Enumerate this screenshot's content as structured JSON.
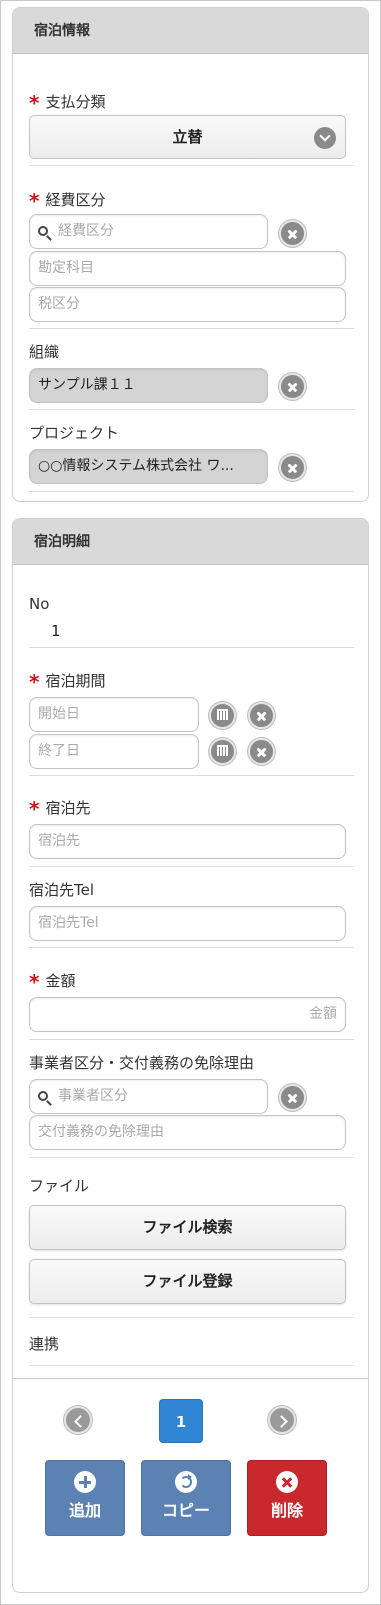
{
  "lodging_info": {
    "header": "宿泊情報",
    "payment_type": {
      "label": "支払分類",
      "value": "立替"
    },
    "expense_category": {
      "label": "経費区分",
      "search_placeholder": "経費区分",
      "account_placeholder": "勘定科目",
      "tax_placeholder": "税区分"
    },
    "organization": {
      "label": "組織",
      "value": "サンプル課１１"
    },
    "project": {
      "label": "プロジェクト",
      "value": "○○情報システム株式会社 ワ..."
    }
  },
  "lodging_detail": {
    "header": "宿泊明細",
    "no": {
      "label": "No",
      "value": "1"
    },
    "period": {
      "label": "宿泊期間",
      "start_placeholder": "開始日",
      "end_placeholder": "終了日"
    },
    "destination": {
      "label": "宿泊先",
      "placeholder": "宿泊先"
    },
    "destination_tel": {
      "label": "宿泊先Tel",
      "placeholder": "宿泊先Tel"
    },
    "amount": {
      "label": "金額",
      "placeholder": "金額"
    },
    "business_type": {
      "label": "事業者区分・交付義務の免除理由",
      "search_placeholder": "事業者区分",
      "reason_placeholder": "交付義務の免除理由"
    },
    "file": {
      "label": "ファイル",
      "search_button": "ファイル検索",
      "register_button": "ファイル登録"
    },
    "link": {
      "label": "連携"
    }
  },
  "pager": {
    "current_page": "1"
  },
  "actions": {
    "add": "追加",
    "copy": "コピー",
    "delete": "削除"
  },
  "colors": {
    "required": "#d4101a",
    "page_active": "#2f86d4",
    "action_blue": "#5b82b3",
    "action_red": "#c9282d"
  }
}
